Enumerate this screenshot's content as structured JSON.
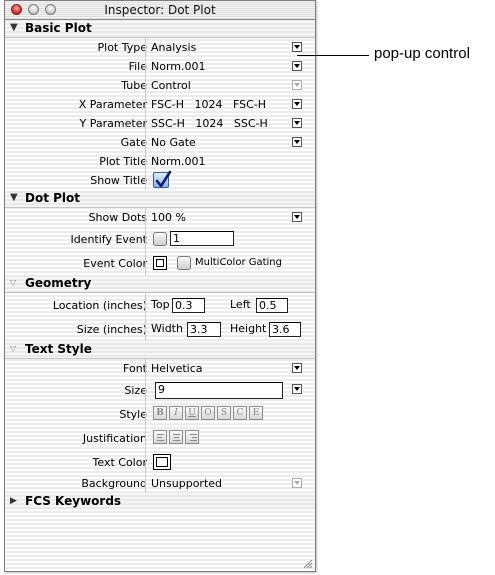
{
  "window": {
    "title": "Inspector: Dot Plot"
  },
  "sections": {
    "basic_plot": "Basic Plot",
    "dot_plot": "Dot Plot",
    "geometry": "Geometry",
    "text_style": "Text Style",
    "fcs_keywords": "FCS Keywords"
  },
  "basic_plot": {
    "plot_type": {
      "label": "Plot Type",
      "value": "Analysis"
    },
    "file": {
      "label": "File",
      "value": "Norm.001"
    },
    "tube": {
      "label": "Tube",
      "value": "Control"
    },
    "x_parameter": {
      "label": "X Parameter",
      "value": "FSC-H   1024   FSC-H"
    },
    "y_parameter": {
      "label": "Y Parameter",
      "value": "SSC-H   1024   SSC-H"
    },
    "gate": {
      "label": "Gate",
      "value": "No Gate"
    },
    "plot_title": {
      "label": "Plot Title",
      "value": "Norm.001"
    },
    "show_title": {
      "label": "Show Title",
      "checked": true
    }
  },
  "dot_plot": {
    "show_dots": {
      "label": "Show Dots",
      "value": "100 %"
    },
    "identify_event": {
      "label": "Identify Event",
      "value": "1"
    },
    "event_color": {
      "label": "Event Color",
      "multicolor_label": "MultiColor Gating"
    }
  },
  "geometry": {
    "location": {
      "label": "Location (inches)",
      "top_label": "Top",
      "top_value": "0.3",
      "left_label": "Left",
      "left_value": "0.5"
    },
    "size": {
      "label": "Size (inches)",
      "width_label": "Width",
      "width_value": "3.3",
      "height_label": "Height",
      "height_value": "3.6"
    }
  },
  "text_style": {
    "font": {
      "label": "Font",
      "value": "Helvetica"
    },
    "size": {
      "label": "Size",
      "value": "9"
    },
    "style": {
      "label": "Style",
      "buttons": [
        "B",
        "I",
        "U",
        "O",
        "S",
        "C",
        "E"
      ]
    },
    "justification": {
      "label": "Justification"
    },
    "text_color": {
      "label": "Text Color"
    },
    "background": {
      "label": "Background",
      "value": "Unsupported"
    }
  },
  "annotation": {
    "label": "pop-up control"
  }
}
